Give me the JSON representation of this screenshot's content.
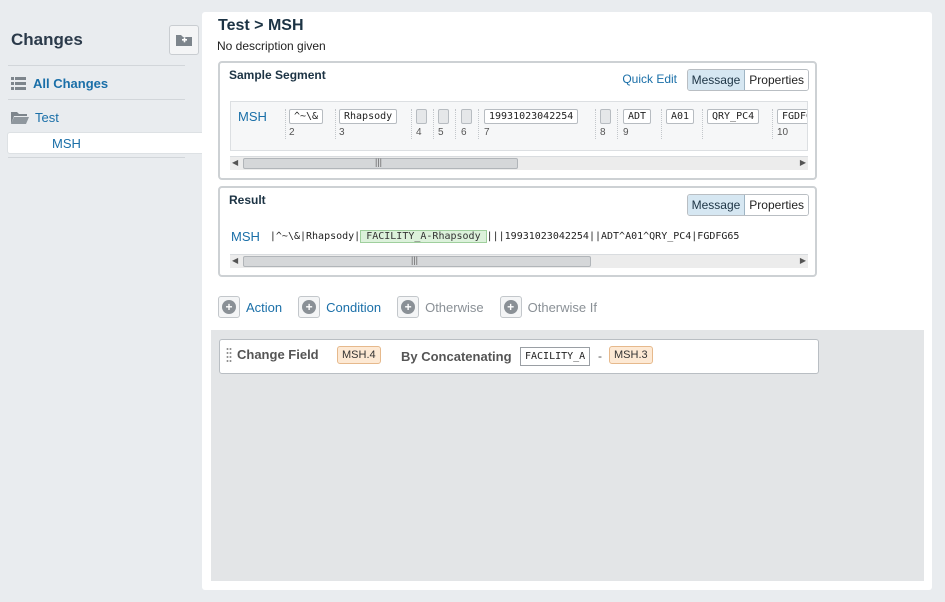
{
  "sidebar": {
    "title": "Changes",
    "all_changes": "All Changes",
    "folder": "Test",
    "selected_item": "MSH"
  },
  "header": {
    "breadcrumb": "Test > MSH",
    "description": "No description given"
  },
  "sample_segment": {
    "title": "Sample Segment",
    "quick_edit": "Quick Edit",
    "tab_message": "Message",
    "tab_properties": "Properties",
    "segment_name": "MSH",
    "fields": [
      {
        "value": "^~\\&",
        "num": "2"
      },
      {
        "value": "Rhapsody",
        "num": "3"
      },
      {
        "value": "",
        "num": "4"
      },
      {
        "value": "",
        "num": "5"
      },
      {
        "value": "",
        "num": "6"
      },
      {
        "value": "19931023042254",
        "num": "7"
      },
      {
        "value": "",
        "num": "8"
      },
      {
        "value": "ADT",
        "num": "9"
      },
      {
        "value": "A01",
        "num": ""
      },
      {
        "value": "QRY_PC4",
        "num": ""
      },
      {
        "value": "FGDFG",
        "num": "10"
      }
    ]
  },
  "result": {
    "title": "Result",
    "tab_message": "Message",
    "tab_properties": "Properties",
    "segment_name": "MSH",
    "text_before": "|^~\\&|Rhapsody|",
    "highlight": "FACILITY_A-Rhapsody",
    "text_after": "|||19931023042254||ADT^A01^QRY_PC4|FGDFG65"
  },
  "actions": [
    {
      "label": "Action",
      "enabled": true
    },
    {
      "label": "Condition",
      "enabled": true
    },
    {
      "label": "Otherwise",
      "enabled": false
    },
    {
      "label": "Otherwise If",
      "enabled": false
    }
  ],
  "rule": {
    "title": "Change Field",
    "target": "MSH.4",
    "operation": "By Concatenating",
    "value": "FACILITY_A",
    "separator": "-",
    "source": "MSH.3"
  },
  "colors": {
    "accent": "#1a6fa8",
    "highlight": "#dcf1db",
    "tag": "#fde9d4"
  }
}
